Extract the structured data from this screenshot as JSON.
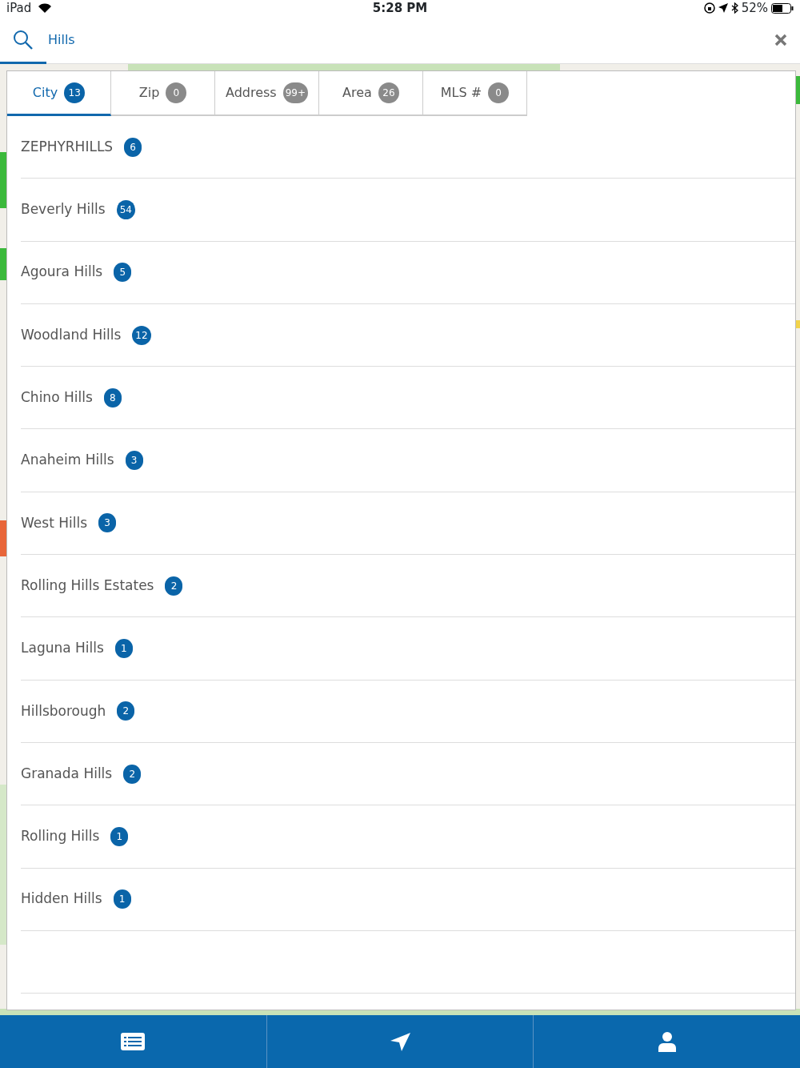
{
  "status_bar": {
    "device": "iPad",
    "time": "5:28 PM",
    "battery": "52%"
  },
  "search": {
    "value": "Hills"
  },
  "tabs": [
    {
      "label": "City",
      "count": "13",
      "selected": true
    },
    {
      "label": "Zip",
      "count": "0",
      "selected": false
    },
    {
      "label": "Address",
      "count": "99+",
      "selected": false
    },
    {
      "label": "Area",
      "count": "26",
      "selected": false
    },
    {
      "label": "MLS #",
      "count": "0",
      "selected": false
    }
  ],
  "results": [
    {
      "name": "ZEPHYRHILLS",
      "count": "6"
    },
    {
      "name": "Beverly Hills",
      "count": "54"
    },
    {
      "name": "Agoura Hills",
      "count": "5"
    },
    {
      "name": "Woodland Hills",
      "count": "12"
    },
    {
      "name": "Chino Hills",
      "count": "8"
    },
    {
      "name": "Anaheim Hills",
      "count": "3"
    },
    {
      "name": "West Hills",
      "count": "3"
    },
    {
      "name": "Rolling Hills Estates",
      "count": "2"
    },
    {
      "name": "Laguna Hills",
      "count": "1"
    },
    {
      "name": "Hillsborough",
      "count": "2"
    },
    {
      "name": "Granada Hills",
      "count": "2"
    },
    {
      "name": "Rolling Hills",
      "count": "1"
    },
    {
      "name": "Hidden Hills",
      "count": "1"
    }
  ],
  "bottom_tabs": [
    {
      "kind": "list"
    },
    {
      "kind": "location"
    },
    {
      "kind": "profile"
    }
  ]
}
